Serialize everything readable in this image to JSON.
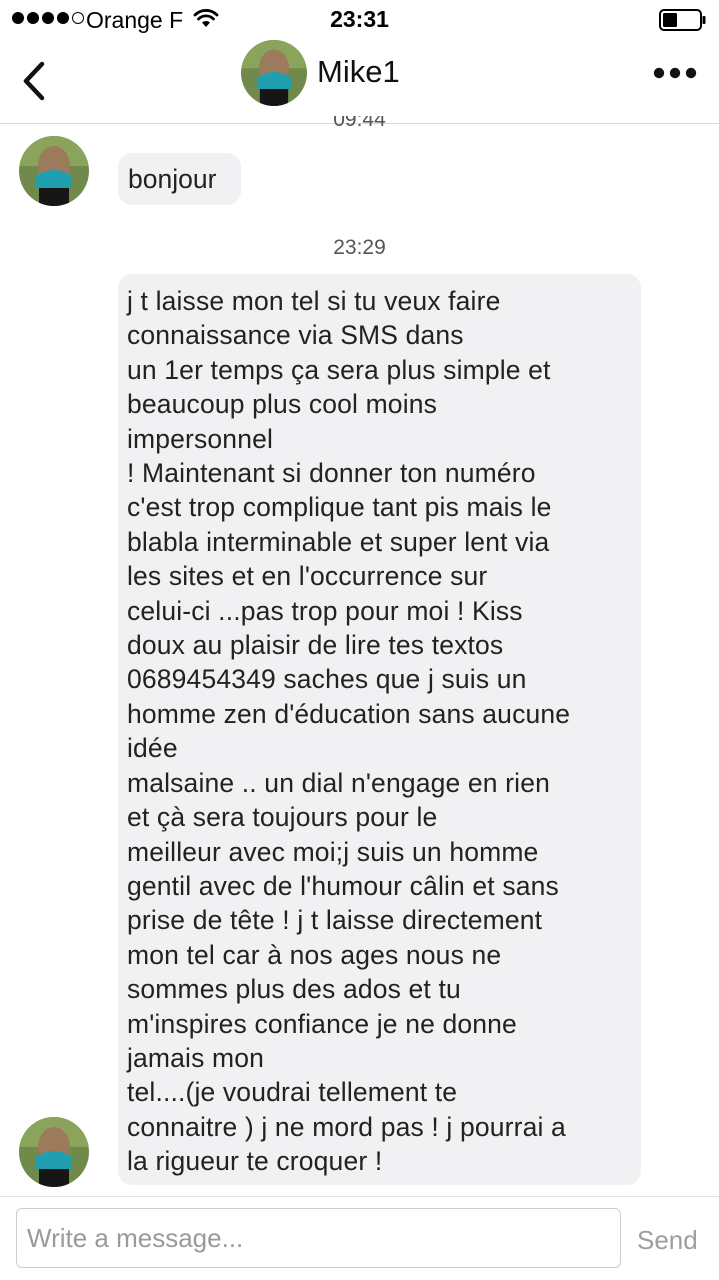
{
  "status_bar": {
    "carrier": "Orange F",
    "time": "23:31"
  },
  "header": {
    "contact_name": "Mike1"
  },
  "messages": [
    {
      "timestamp": "09:44",
      "text": "bonjour"
    },
    {
      "timestamp": "23:29",
      "text": "j t laisse mon tel si tu veux faire\nconnaissance via SMS dans\nun 1er temps ça sera plus simple et\nbeaucoup plus cool moins\nimpersonnel\n! Maintenant si donner ton numéro\nc'est trop complique tant pis mais le\nblabla interminable et super lent via\nles sites et en l'occurrence sur\ncelui-ci ...pas trop pour moi ! Kiss\ndoux au plaisir de lire tes textos\n0689454349 saches que j suis un\nhomme zen d'éducation sans aucune\nidée\nmalsaine .. un dial n'engage en rien\net çà sera toujours pour le\nmeilleur avec moi;j suis un homme\ngentil avec de l'humour câlin et sans\nprise de tête ! j t laisse directement\nmon tel car à nos ages nous ne\nsommes plus des ados et tu\nm'inspires confiance je ne donne\njamais mon\ntel....(je voudrai tellement te\nconnaitre ) j ne mord pas ! j pourrai a\nla rigueur te croquer !"
    }
  ],
  "composer": {
    "placeholder": "Write a message...",
    "send_label": "Send"
  },
  "icons": {
    "back": "chevron-left-icon",
    "more": "more-dots-icon",
    "wifi": "wifi-icon",
    "battery": "battery-icon"
  },
  "colors": {
    "bubble_background": "#f1f1f3",
    "send_disabled": "#9d9da2"
  }
}
